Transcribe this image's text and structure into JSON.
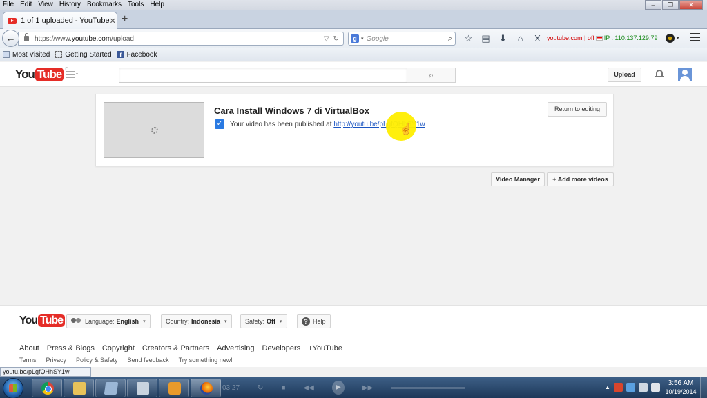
{
  "browser": {
    "menu": [
      "File",
      "Edit",
      "View",
      "History",
      "Bookmarks",
      "Tools",
      "Help"
    ],
    "window_controls": {
      "minimize": "–",
      "restore": "❐",
      "close": "✕"
    },
    "tab": {
      "title": "1 of 1 uploaded - YouTube",
      "close": "✕"
    },
    "new_tab": "+",
    "back": "←",
    "url": {
      "prefix": "https://www.",
      "domain": "youtube.com",
      "path": "/upload",
      "caret": "▽",
      "reload": "↻"
    },
    "search": {
      "engine_icon": "g",
      "caret": "▾",
      "placeholder": "Google",
      "icon": "⌕"
    },
    "nav_icons": [
      "☆",
      "▤",
      "⬇",
      "⌂",
      "X"
    ],
    "addon": {
      "site": "youtube.com",
      "sep": " | ",
      "state": "off",
      "ip": "IP : 110.137.129.79"
    },
    "ext_caret": "▾",
    "bookmarks": [
      "Most Visited",
      "Getting Started",
      "Facebook"
    ],
    "status_url": "youtu.be/pLgfQHhSY1w"
  },
  "youtube": {
    "logo": {
      "you": "You",
      "tube": "Tube",
      "country": "ID"
    },
    "search_icon": "⌕",
    "upload_label": "Upload",
    "video": {
      "title": "Cara Install Windows 7 di VirtualBox",
      "check": "✓",
      "published_prefix": "Your video has been published at ",
      "link": "http://youtu.be/pLgfQHhSY1w"
    },
    "return_label": "Return to editing",
    "video_manager_label": "Video Manager",
    "add_more_label": "+ Add more videos",
    "cursor": "☝",
    "footer": {
      "language_prefix": "Language:",
      "language": "English",
      "country_prefix": "Country:",
      "country": "Indonesia",
      "safety_prefix": "Safety:",
      "safety": "Off",
      "caret": "▾",
      "help_icon": "?",
      "help": "Help",
      "links": [
        "About",
        "Press & Blogs",
        "Copyright",
        "Creators & Partners",
        "Advertising",
        "Developers",
        "+YouTube"
      ],
      "sublinks": [
        "Terms",
        "Privacy",
        "Policy & Safety",
        "Send feedback",
        "Try something new!"
      ]
    }
  },
  "taskbar": {
    "media": {
      "time": "03:27",
      "prev": "◀◀",
      "play": "▶",
      "next": "▶▶",
      "stop": "■",
      "loop": "↻"
    },
    "tray_caret": "▲",
    "time": "3:56 AM",
    "date": "10/19/2014"
  },
  "colors": {
    "youtube_red": "#e52d27",
    "link_blue": "#1b55c2",
    "checkbox_blue": "#2a7ae2",
    "cursor_highlight": "#ffee00",
    "addon_red": "#d20000",
    "ip_green": "#198a1a"
  }
}
